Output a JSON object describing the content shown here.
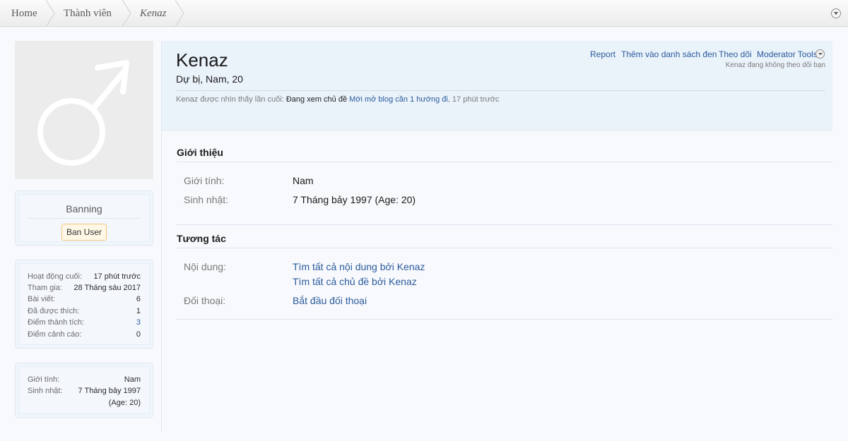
{
  "breadcrumb": {
    "home": "Home",
    "members": "Thành viên",
    "current": "Kenaz"
  },
  "sidebar": {
    "banning": {
      "title": "Banning",
      "button": "Ban User"
    },
    "stats": [
      {
        "label": "Hoạt động cuối:",
        "value": "17 phút trước"
      },
      {
        "label": "Tham gia:",
        "value": "28 Tháng sáu 2017"
      },
      {
        "label": "Bài viết:",
        "value": "6"
      },
      {
        "label": "Đã được thích:",
        "value": "1"
      },
      {
        "label": "Điểm thành tích:",
        "value": "3"
      },
      {
        "label": "Điểm cảnh cáo:",
        "value": "0"
      }
    ],
    "info": {
      "gender_label": "Giới tính:",
      "gender_value": "Nam",
      "birthday_label": "Sinh nhật:",
      "birthday_value": "7 Tháng bảy 1997",
      "age_value": "(Age: 20)"
    }
  },
  "header": {
    "username": "Kenaz",
    "meta": "Dự bị, Nam, 20",
    "lastseen_prefix": "Kenaz được nhìn thấy lần cuối:",
    "lastseen_action": "Đang xem chủ đề",
    "lastseen_link": "Mới mở blog cần 1 hướng đi",
    "lastseen_time": ", 17 phút trước",
    "links": {
      "report": "Report",
      "ignore": "Thêm vào danh sách đen",
      "follow": "Theo dõi",
      "moderator_tools": "Moderator Tools"
    },
    "follow_status": "Kenaz đang không theo dõi bạn"
  },
  "about": {
    "title": "Giới thiệu",
    "gender_label": "Giới tính:",
    "gender_value": "Nam",
    "birthday_label": "Sinh nhật:",
    "birthday_value": "7 Tháng bảy 1997 (Age: 20)"
  },
  "interact": {
    "title": "Tương tác",
    "content_label": "Nội dung:",
    "content_link_1": "Tìm tất cả nội dung bởi Kenaz",
    "content_link_2": "Tìm tất cả chủ đề bởi Kenaz",
    "conversation_label": "Đối thoại:",
    "conversation_link": "Bắt đầu đối thoại"
  },
  "colors": {
    "link": "#2b5b9c",
    "header_bg": "#eaf2fa",
    "ban_button_bg": "#fff8e7",
    "ban_button_border": "#f0c57b"
  },
  "icons": {
    "avatar": "male-symbol-icon",
    "jump_menu": "chevron-down-circle-icon",
    "moderator_tools": "chevron-down-circle-icon"
  }
}
